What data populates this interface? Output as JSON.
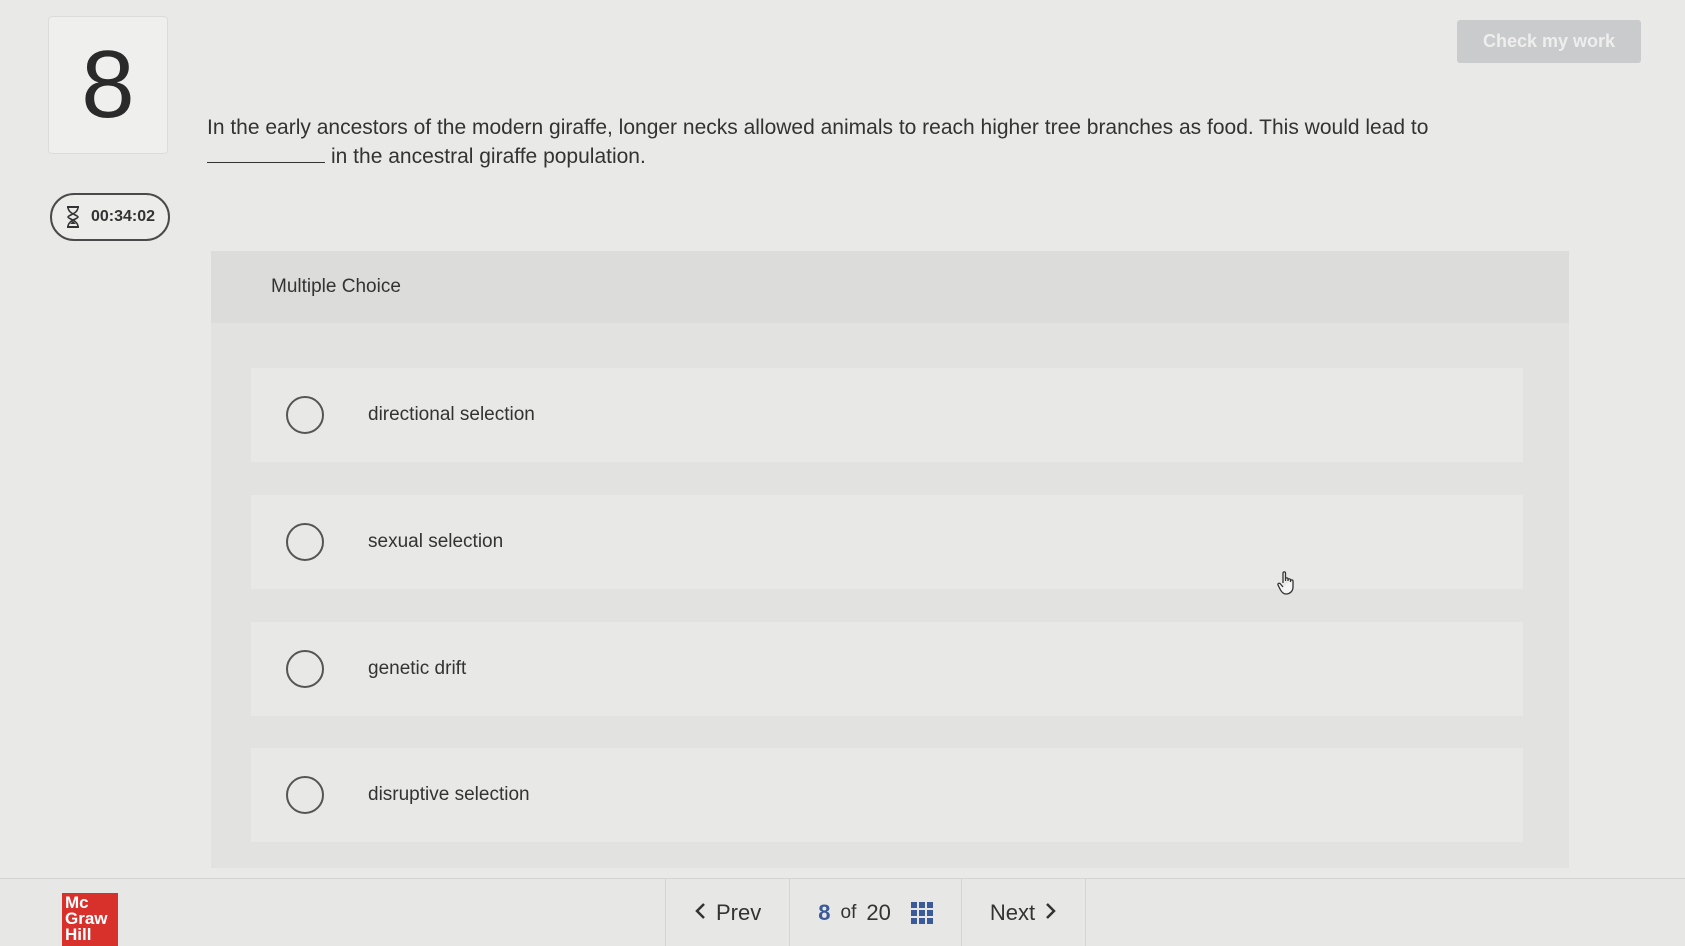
{
  "question": {
    "number": "8",
    "text_before_blank": "In the early ancestors of the modern giraffe, longer necks allowed animals to reach higher tree branches as food. This would lead to",
    "text_after_blank": "in the ancestral giraffe population."
  },
  "timer": {
    "icon": "hourglass-icon",
    "value": "00:34:02"
  },
  "toolbar": {
    "check_label": "Check my work"
  },
  "multiple_choice": {
    "header": "Multiple Choice",
    "options": [
      {
        "label": "directional selection",
        "selected": false
      },
      {
        "label": "sexual selection",
        "selected": false
      },
      {
        "label": "genetic drift",
        "selected": false
      },
      {
        "label": "disruptive selection",
        "selected": false
      }
    ]
  },
  "footer": {
    "logo_lines": [
      "Mc",
      "Graw",
      "Hill"
    ],
    "prev_label": "Prev",
    "next_label": "Next",
    "current_page": "8",
    "of_label": "of",
    "total_pages": "20"
  },
  "colors": {
    "accent": "#3a5a9a",
    "logo_red": "#d8312c",
    "check_button": "#c9cbcc"
  }
}
